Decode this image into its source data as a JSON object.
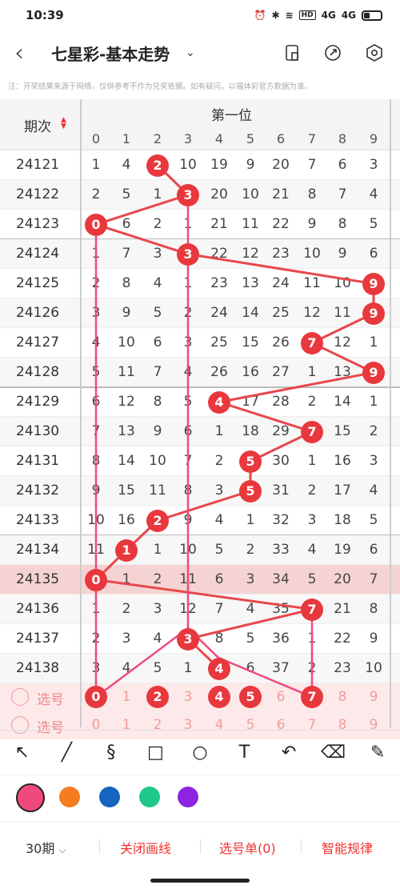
{
  "status": {
    "time": "10:39",
    "net": "HD",
    "signal1": "4G",
    "signal2": "4G"
  },
  "header": {
    "title": "七星彩-基本走势"
  },
  "notice": "注：开奖结果来源于网络，仅供参考不作为兑奖依据。如有疑问，以福体彩官方数据为准。",
  "table": {
    "period_header": "期次",
    "sort_up": "▲",
    "sort_down": "▼",
    "position_header": "第一位",
    "digits": [
      "0",
      "1",
      "2",
      "3",
      "4",
      "5",
      "6",
      "7",
      "8",
      "9"
    ],
    "rows": [
      {
        "period": "24121",
        "cells": [
          "1",
          "4",
          "2",
          "10",
          "19",
          "9",
          "20",
          "7",
          "6",
          "3"
        ],
        "hit": 2
      },
      {
        "period": "24122",
        "cells": [
          "2",
          "5",
          "1",
          "3",
          "20",
          "10",
          "21",
          "8",
          "7",
          "4"
        ],
        "hit": 3
      },
      {
        "period": "24123",
        "cells": [
          "0",
          "6",
          "2",
          "1",
          "21",
          "11",
          "22",
          "9",
          "8",
          "5"
        ],
        "hit": 0
      },
      {
        "period": "24124",
        "cells": [
          "1",
          "7",
          "3",
          "3",
          "22",
          "12",
          "23",
          "10",
          "9",
          "6"
        ],
        "hit": 3
      },
      {
        "period": "24125",
        "cells": [
          "2",
          "8",
          "4",
          "1",
          "23",
          "13",
          "24",
          "11",
          "10",
          "9"
        ],
        "hit": 9
      },
      {
        "period": "24126",
        "cells": [
          "3",
          "9",
          "5",
          "2",
          "24",
          "14",
          "25",
          "12",
          "11",
          "9"
        ],
        "hit": 9
      },
      {
        "period": "24127",
        "cells": [
          "4",
          "10",
          "6",
          "3",
          "25",
          "15",
          "26",
          "7",
          "12",
          "1"
        ],
        "hit": 7
      },
      {
        "period": "24128",
        "cells": [
          "5",
          "11",
          "7",
          "4",
          "26",
          "16",
          "27",
          "1",
          "13",
          "9"
        ],
        "hit": 9
      },
      {
        "period": "24129",
        "cells": [
          "6",
          "12",
          "8",
          "5",
          "4",
          "17",
          "28",
          "2",
          "14",
          "1"
        ],
        "hit": 4
      },
      {
        "period": "24130",
        "cells": [
          "7",
          "13",
          "9",
          "6",
          "1",
          "18",
          "29",
          "7",
          "15",
          "2"
        ],
        "hit": 7
      },
      {
        "period": "24131",
        "cells": [
          "8",
          "14",
          "10",
          "7",
          "2",
          "5",
          "30",
          "1",
          "16",
          "3"
        ],
        "hit": 5
      },
      {
        "period": "24132",
        "cells": [
          "9",
          "15",
          "11",
          "8",
          "3",
          "5",
          "31",
          "2",
          "17",
          "4"
        ],
        "hit": 5
      },
      {
        "period": "24133",
        "cells": [
          "10",
          "16",
          "2",
          "9",
          "4",
          "1",
          "32",
          "3",
          "18",
          "5"
        ],
        "hit": 2
      },
      {
        "period": "24134",
        "cells": [
          "11",
          "1",
          "1",
          "10",
          "5",
          "2",
          "33",
          "4",
          "19",
          "6"
        ],
        "hit": 1
      },
      {
        "period": "24135",
        "cells": [
          "0",
          "1",
          "2",
          "11",
          "6",
          "3",
          "34",
          "5",
          "20",
          "7"
        ],
        "hit": 0
      },
      {
        "period": "24136",
        "cells": [
          "1",
          "2",
          "3",
          "12",
          "7",
          "4",
          "35",
          "7",
          "21",
          "8"
        ],
        "hit": 7
      },
      {
        "period": "24137",
        "cells": [
          "2",
          "3",
          "4",
          "3",
          "8",
          "5",
          "36",
          "1",
          "22",
          "9"
        ],
        "hit": 3
      },
      {
        "period": "24138",
        "cells": [
          "3",
          "4",
          "5",
          "1",
          "4",
          "6",
          "37",
          "2",
          "23",
          "10"
        ],
        "hit": 4
      }
    ],
    "select_rows": [
      {
        "label": "选号",
        "cells": [
          "0",
          "1",
          "2",
          "3",
          "4",
          "5",
          "6",
          "7",
          "8",
          "9"
        ]
      },
      {
        "label": "选号",
        "cells": [
          "0",
          "1",
          "2",
          "3",
          "4",
          "5",
          "6",
          "7",
          "8",
          "9"
        ]
      }
    ],
    "selected_balls": [
      0,
      2,
      4,
      5,
      7
    ]
  },
  "tools": [
    "arrow-tool-icon",
    "line-tool-icon",
    "freehand-tool-icon",
    "rectangle-tool-icon",
    "circle-tool-icon",
    "text-tool-icon",
    "undo-icon",
    "eraser-icon",
    "clear-brush-icon"
  ],
  "tool_glyphs": {
    "arrow": "↖",
    "line": "╱",
    "freehand": "§",
    "rect": "□",
    "circle": "○",
    "text": "T",
    "undo": "↶",
    "eraser": "⌫",
    "clear": "✎"
  },
  "palette": [
    "#f04a7c",
    "#f57c1f",
    "#1565c0",
    "#20c98a",
    "#8e24e0"
  ],
  "bottom": {
    "periods": "30期",
    "close_lines": "关闭画线",
    "selection": "选号单(0)",
    "smart": "智能规律"
  }
}
